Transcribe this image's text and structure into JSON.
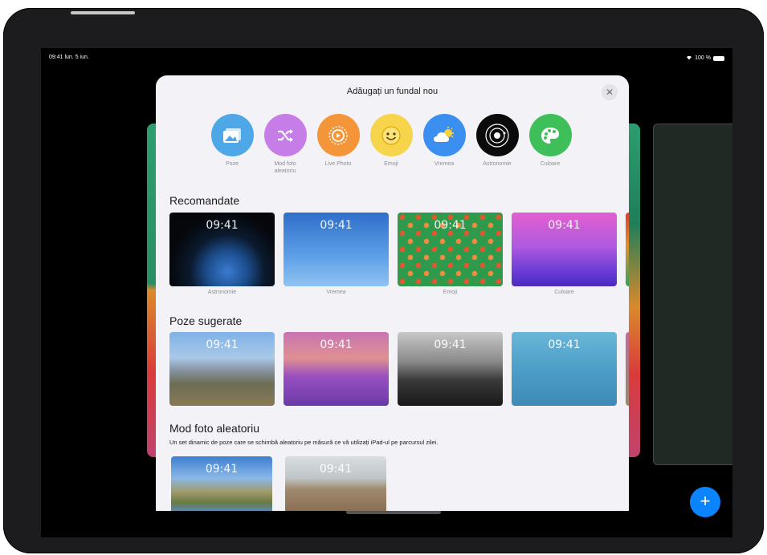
{
  "status": {
    "time": "09:41 lun. 5 iun.",
    "battery": "100 %"
  },
  "sheet": {
    "title": "Adăugați un fundal nou",
    "close": "✕"
  },
  "types": [
    {
      "label": "Poze",
      "icon": "photos-icon",
      "color": "#4ea7e6"
    },
    {
      "label": "Mod foto aleatoriu",
      "icon": "shuffle-icon",
      "color": "#c77de8"
    },
    {
      "label": "Live Photo",
      "icon": "live-photo-icon",
      "color": "#f5953a"
    },
    {
      "label": "Emoji",
      "icon": "emoji-icon",
      "color": "#f6d44b"
    },
    {
      "label": "Vremea",
      "icon": "weather-icon",
      "color": "#3a8ff0"
    },
    {
      "label": "Astronomie",
      "icon": "astronomy-icon",
      "color": "#0b0b0c"
    },
    {
      "label": "Culoare",
      "icon": "palette-icon",
      "color": "#3fbf5a"
    }
  ],
  "recommended": {
    "title": "Recomandate",
    "items": [
      {
        "label": "Astronomie",
        "time": "09:41"
      },
      {
        "label": "Vremea",
        "time": "09:41"
      },
      {
        "label": "Emoji",
        "time": "09:41"
      },
      {
        "label": "Culoare",
        "time": "09:41"
      }
    ]
  },
  "suggested": {
    "title": "Poze sugerate",
    "items": [
      {
        "time": "09:41"
      },
      {
        "time": "09:41"
      },
      {
        "time": "09:41"
      },
      {
        "time": "09:41"
      }
    ]
  },
  "shuffle": {
    "title": "Mod foto aleatoriu",
    "subtitle": "Un set dinamic de poze care se schimbă aleatoriu pe măsură ce vă utilizați iPad-ul pe parcursul zilei.",
    "items": [
      {
        "time": "09:41"
      },
      {
        "time": "09:41"
      }
    ]
  },
  "fab": "+"
}
